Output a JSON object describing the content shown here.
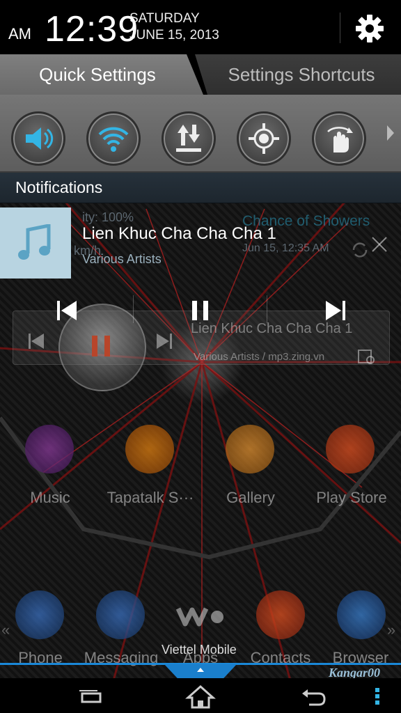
{
  "status": {
    "ampm": "AM",
    "time": "12:39",
    "day": "SATURDAY",
    "date": "JUNE 15, 2013"
  },
  "tabs": {
    "quick_settings": "Quick Settings",
    "settings_shortcuts": "Settings Shortcuts"
  },
  "quick_settings": [
    {
      "name": "sound-icon",
      "color": "#33b5e5"
    },
    {
      "name": "wifi-icon",
      "color": "#33b5e5"
    },
    {
      "name": "data-transfer-icon",
      "color": "#eeeeee"
    },
    {
      "name": "gps-icon",
      "color": "#eeeeee"
    },
    {
      "name": "auto-rotate-icon",
      "color": "#eeeeee"
    }
  ],
  "notifications": {
    "header": "Notifications",
    "music": {
      "title": "Lien Khuc Cha Cha Cha 1",
      "artist": "Various Artists"
    }
  },
  "background": {
    "weather_humidity": "ity: 100%",
    "weather_wind": "km/h",
    "weather_forecast": "Chance of Showers",
    "weather_time": "Jun 15, 12:35 AM",
    "widget_title": "Lien Khuc Cha Cha Cha 1",
    "widget_subtitle": "Various Artists / mp3.zing.vn",
    "apps": [
      "Music",
      "Tapatalk S···",
      "Gallery",
      "Play Store"
    ],
    "dock": [
      "Phone",
      "Messaging",
      "Apps",
      "Contacts",
      "Browser"
    ],
    "carrier": "Viettel Mobile",
    "signature": "Kangar00"
  }
}
